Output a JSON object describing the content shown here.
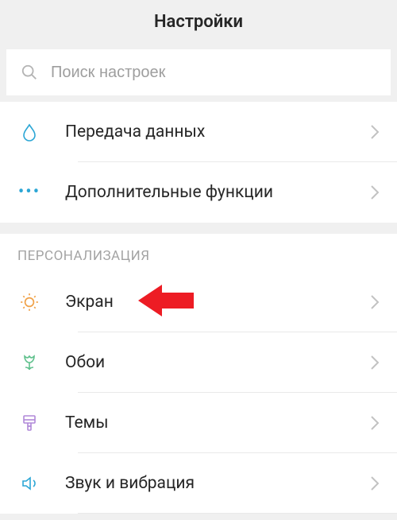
{
  "header": {
    "title": "Настройки"
  },
  "search": {
    "placeholder": "Поиск настроек"
  },
  "group_top": {
    "items": [
      {
        "label": "Передача данных",
        "icon": "drop"
      },
      {
        "label": "Дополнительные функции",
        "icon": "dots"
      }
    ]
  },
  "group_personalization": {
    "header": "ПЕРСОНАЛИЗАЦИЯ",
    "items": [
      {
        "label": "Экран",
        "icon": "sun"
      },
      {
        "label": "Обои",
        "icon": "tulip"
      },
      {
        "label": "Темы",
        "icon": "brush"
      },
      {
        "label": "Звук и вибрация",
        "icon": "speaker"
      }
    ]
  },
  "colors": {
    "accent_orange": "#f0a24a",
    "accent_green": "#5fc08c",
    "accent_purple": "#b088d9",
    "accent_blue": "#2ba6d5"
  }
}
